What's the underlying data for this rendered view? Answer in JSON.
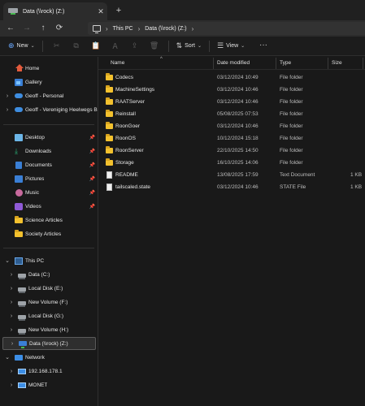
{
  "tab": {
    "title": "Data (\\\\rock) (Z:)",
    "close_glyph": "✕",
    "new_tab_glyph": "+"
  },
  "nav": {
    "back_glyph": "←",
    "forward_glyph": "→",
    "up_glyph": "↑",
    "refresh_glyph": "⟳",
    "breadcrumb": [
      "This PC",
      "Data (\\\\rock) (Z:)"
    ],
    "sep_glyph": "›"
  },
  "commands": {
    "new_label": "New",
    "sort_label": "Sort",
    "view_label": "View",
    "more_glyph": "···",
    "new_glyph": "⊕",
    "cut_glyph": "✂",
    "copy_glyph": "⧉",
    "paste_glyph": "📋",
    "rename_glyph": "Ａ",
    "share_glyph": "⇪",
    "delete_glyph": "🗑",
    "sort_glyph": "⇅",
    "view_glyph": "☰",
    "dropdown_glyph": "⌄"
  },
  "sidebar": {
    "items": [
      {
        "label": "Home",
        "icon": "home-icon"
      },
      {
        "label": "Gallery",
        "icon": "gallery-icon"
      },
      {
        "label": "Geoff - Personal",
        "icon": "cloud-icon"
      },
      {
        "label": "Geoff - Vereniging Heelwegs Be",
        "icon": "cloud-icon"
      },
      {
        "label": "Desktop",
        "icon": "desktop-icon"
      },
      {
        "label": "Downloads",
        "icon": "downloads-icon"
      },
      {
        "label": "Documents",
        "icon": "documents-icon"
      },
      {
        "label": "Pictures",
        "icon": "pictures-icon"
      },
      {
        "label": "Music",
        "icon": "music-icon"
      },
      {
        "label": "Videos",
        "icon": "videos-icon"
      },
      {
        "label": "Science Articles",
        "icon": "folder-icon"
      },
      {
        "label": "Society Articles",
        "icon": "folder-icon"
      },
      {
        "label": "This PC",
        "icon": "pc-icon"
      },
      {
        "label": "Data (C:)",
        "icon": "drive-icon"
      },
      {
        "label": "Local Disk (E:)",
        "icon": "drive-icon"
      },
      {
        "label": "New Volume (F:)",
        "icon": "drive-icon"
      },
      {
        "label": "Local Disk (G:)",
        "icon": "drive-icon"
      },
      {
        "label": "New Volume (H:)",
        "icon": "drive-icon"
      },
      {
        "label": "Data (\\\\rock) (Z:)",
        "icon": "network-drive-icon"
      },
      {
        "label": "Network",
        "icon": "network-icon"
      },
      {
        "label": "192.168.178.1",
        "icon": "monitor-icon"
      },
      {
        "label": "MONET",
        "icon": "monitor-icon"
      }
    ],
    "pin_glyph": "📌",
    "chevron_right": "›",
    "chevron_down": "⌄"
  },
  "columns": {
    "name": "Name",
    "date": "Date modified",
    "type": "Type",
    "size": "Size",
    "sort_caret": "^"
  },
  "files": [
    {
      "name": "Codecs",
      "date": "03/12/2024 10:49",
      "type": "File folder",
      "size": "",
      "kind": "folder"
    },
    {
      "name": "MachineSettings",
      "date": "03/12/2024 10:46",
      "type": "File folder",
      "size": "",
      "kind": "folder"
    },
    {
      "name": "RAATServer",
      "date": "03/12/2024 10:46",
      "type": "File folder",
      "size": "",
      "kind": "folder"
    },
    {
      "name": "Reinstall",
      "date": "05/08/2025 07:53",
      "type": "File folder",
      "size": "",
      "kind": "folder"
    },
    {
      "name": "RoonGoer",
      "date": "03/12/2024 10:46",
      "type": "File folder",
      "size": "",
      "kind": "folder"
    },
    {
      "name": "RoonOS",
      "date": "10/12/2024 15:18",
      "type": "File folder",
      "size": "",
      "kind": "folder"
    },
    {
      "name": "RoonServer",
      "date": "22/10/2025 14:50",
      "type": "File folder",
      "size": "",
      "kind": "folder"
    },
    {
      "name": "Storage",
      "date": "16/10/2025 14:06",
      "type": "File folder",
      "size": "",
      "kind": "folder"
    },
    {
      "name": "README",
      "date": "13/08/2025 17:59",
      "type": "Text Document",
      "size": "1 KB",
      "kind": "file"
    },
    {
      "name": "tailscaled.state",
      "date": "03/12/2024 10:46",
      "type": "STATE File",
      "size": "1 KB",
      "kind": "file"
    }
  ]
}
